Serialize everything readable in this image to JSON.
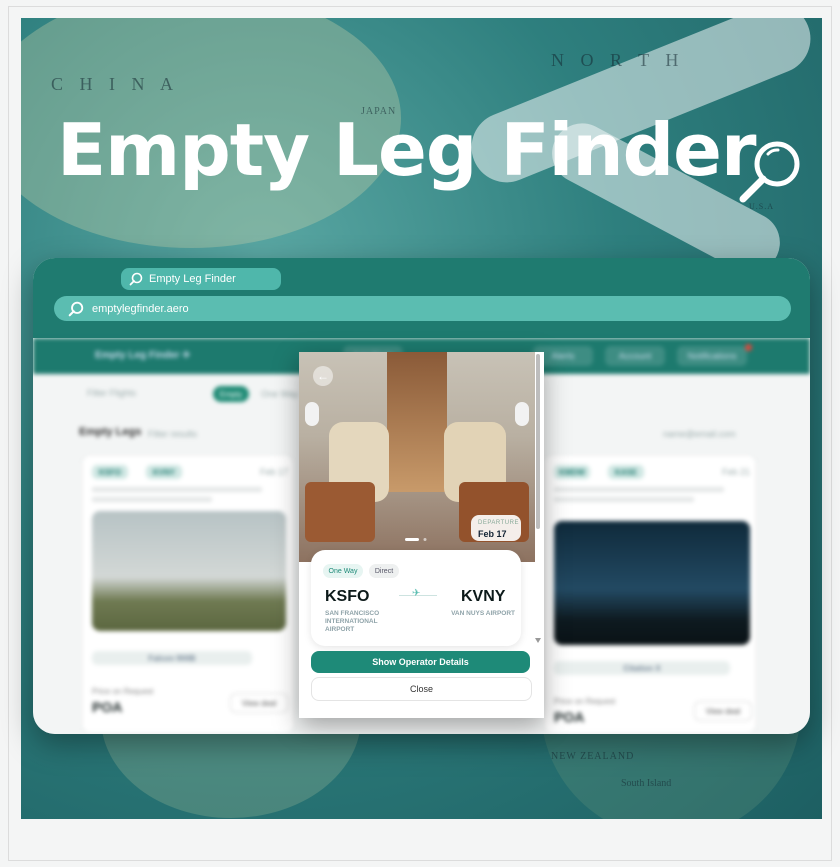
{
  "hero": {
    "title": "Empty Leg Finder",
    "map_labels": [
      "C H I N A",
      "JAPAN",
      "N O R T H",
      "NEW ZEALAND",
      "South Island",
      "U.S.A"
    ]
  },
  "browser": {
    "tab_label": "Empty Leg Finder",
    "url": "emptylegfinder.aero"
  },
  "app": {
    "brand": "Empty Leg Finder ✈",
    "nav_items": [
      "Add Flight",
      "Alerts",
      "Account",
      "Notifications"
    ],
    "filter_label": "Filter Flights",
    "segments": [
      "Empty",
      "One Way"
    ],
    "section_title": "Empty Legs",
    "section_sub": "Filter results",
    "user_email": "name@email.com",
    "cards": [
      {
        "from": "KSFO",
        "to": "KVNY",
        "date": "Feb 17",
        "aircraft": "Falcon 900B",
        "price_label": "Price on Request",
        "price": "POA",
        "button": "View deal"
      },
      {
        "from": "KMDW",
        "to": "KASE",
        "date": "Feb 21",
        "aircraft": "Citation X",
        "price_label": "Price on Request",
        "price": "POA",
        "button": "View deal"
      }
    ]
  },
  "modal": {
    "back": "←",
    "departure_label": "DEPARTURE",
    "departure_date": "Feb 17",
    "tags": [
      "One Way",
      "Direct"
    ],
    "origin_code": "KSFO",
    "origin_name": "SAN FRANCISCO INTERNATIONAL AIRPORT",
    "destination_code": "KVNY",
    "destination_name": "VAN NUYS AIRPORT",
    "primary_button": "Show Operator Details",
    "secondary_button": "Close"
  },
  "colors": {
    "brand": "#1f7b70",
    "accent": "#5bbdb1",
    "button": "#1e8a78"
  }
}
